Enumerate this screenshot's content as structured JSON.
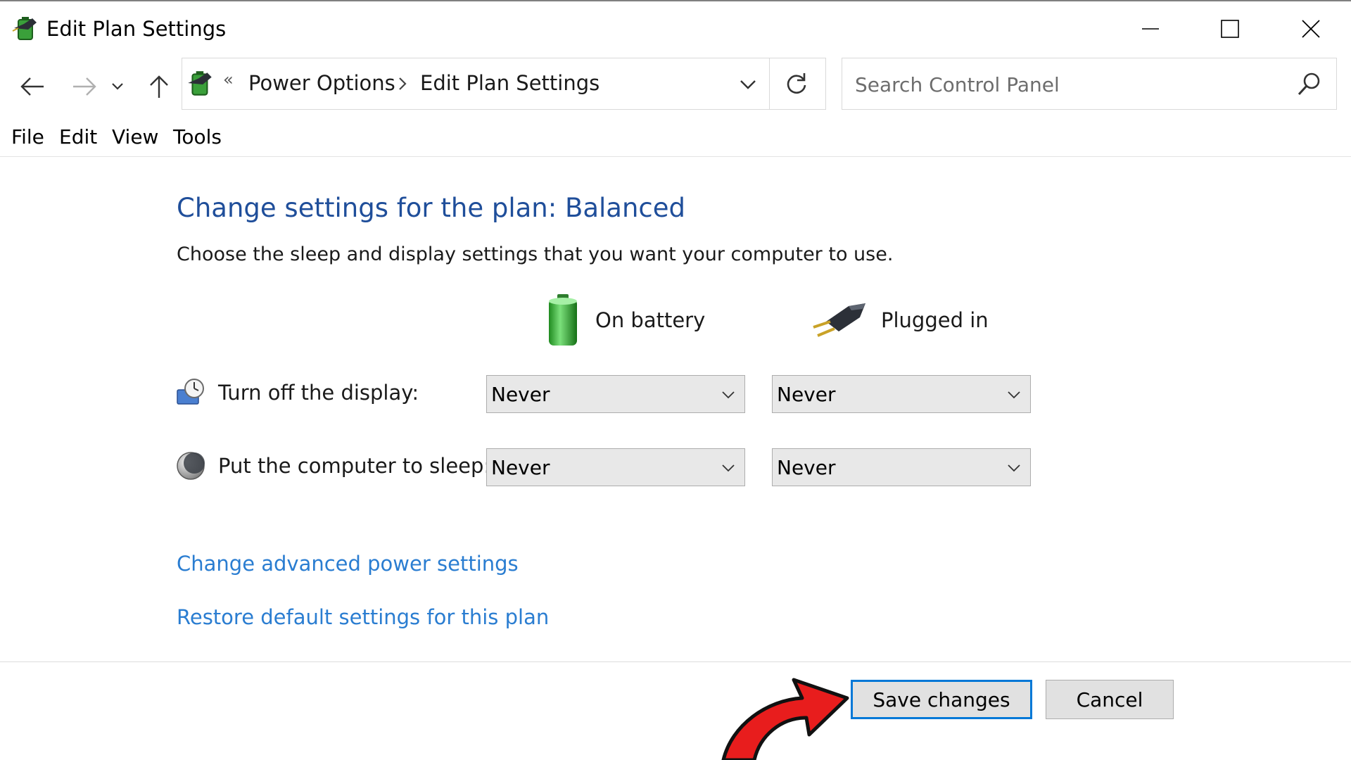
{
  "window": {
    "title": "Edit Plan Settings"
  },
  "address_bar": {
    "overflow_glyph": "«",
    "breadcrumbs": [
      "Power Options",
      "Edit Plan Settings"
    ]
  },
  "search": {
    "placeholder": "Search Control Panel"
  },
  "menu": {
    "items": [
      "File",
      "Edit",
      "View",
      "Tools"
    ]
  },
  "content": {
    "heading": "Change settings for the plan: Balanced",
    "subtext": "Choose the sleep and display settings that you want your computer to use.",
    "columns": {
      "battery": "On battery",
      "plugged": "Plugged in"
    },
    "rows": [
      {
        "label": "Turn off the display:",
        "battery_value": "Never",
        "plugged_value": "Never"
      },
      {
        "label": "Put the computer to sleep:",
        "battery_value": "Never",
        "plugged_value": "Never"
      }
    ],
    "links": {
      "advanced": "Change advanced power settings",
      "restore": "Restore default settings for this plan"
    }
  },
  "buttons": {
    "save": "Save changes",
    "cancel": "Cancel"
  },
  "colors": {
    "heading": "#1f4e9a",
    "link": "#2a7dd1",
    "focus_border": "#0078d7",
    "annotation_arrow": "#e81d1d"
  }
}
